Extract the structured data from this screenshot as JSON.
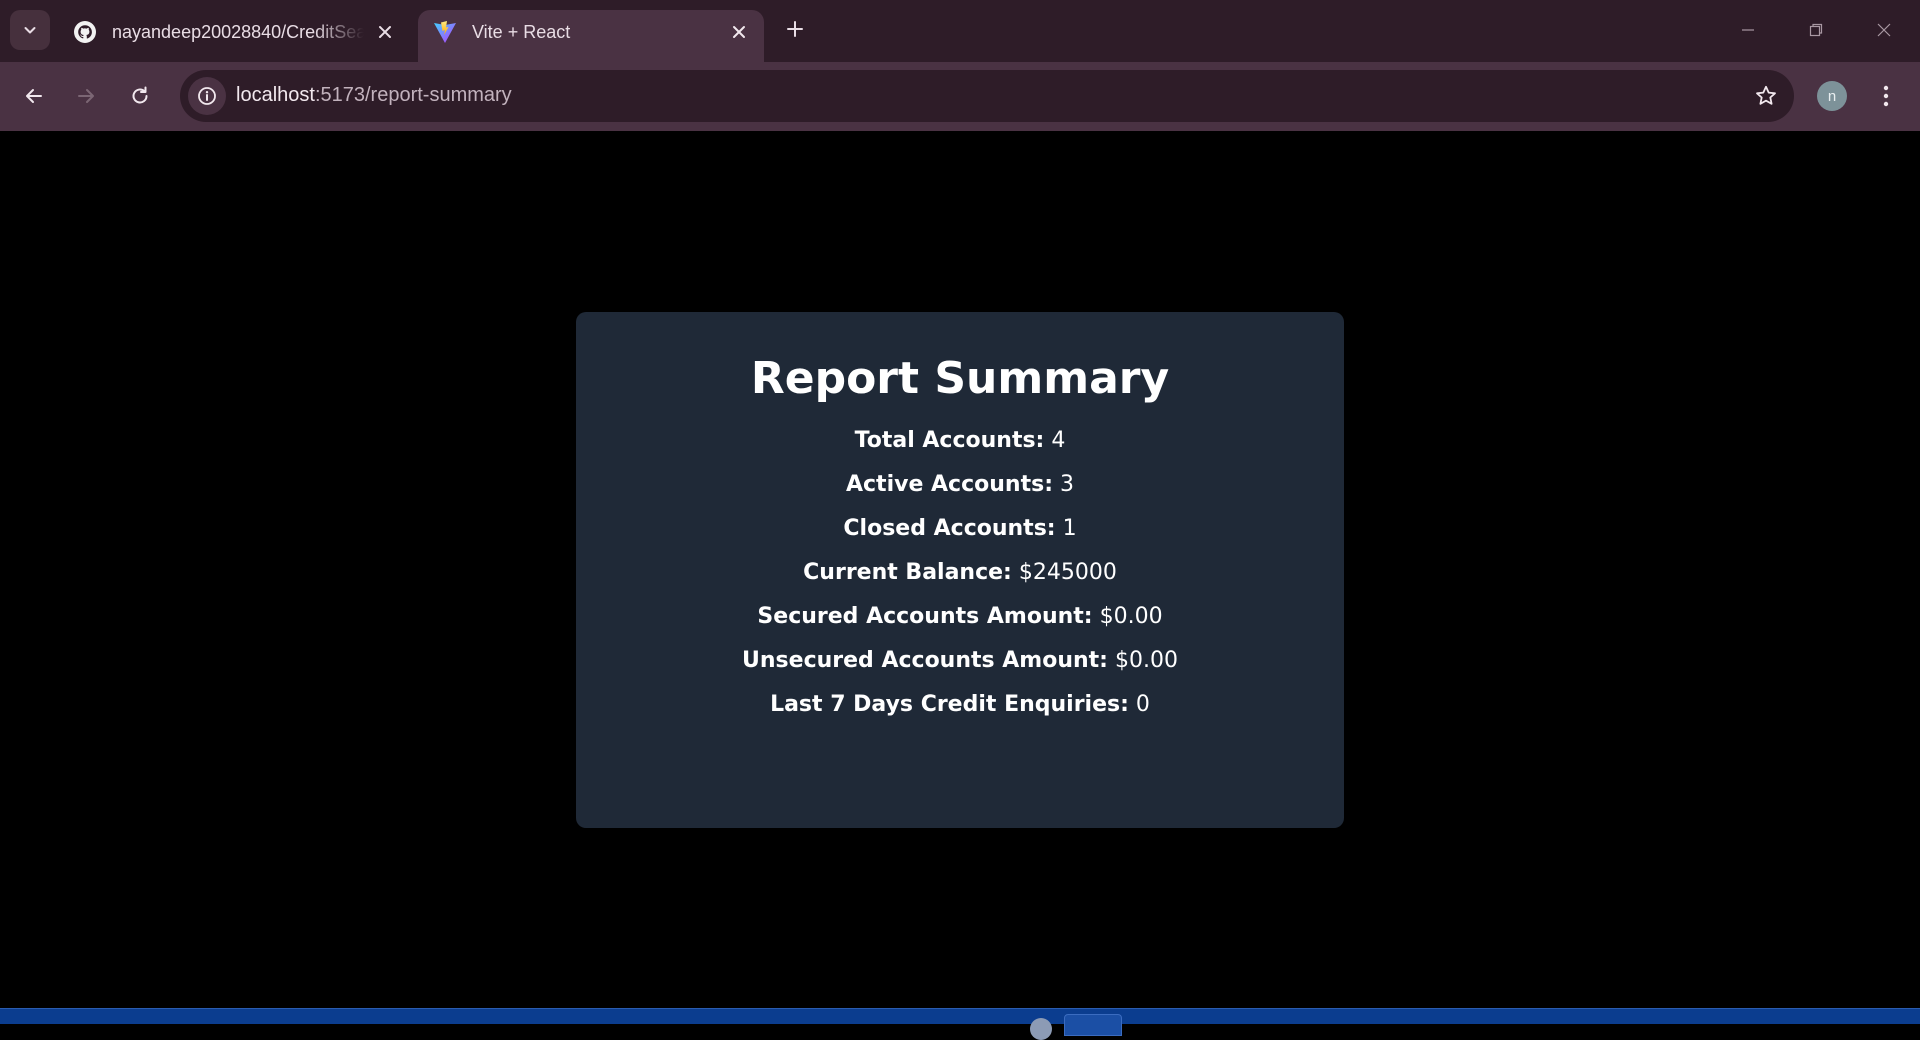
{
  "browser": {
    "tabs": [
      {
        "title": "nayandeep20028840/CreditSea",
        "favicon": "github-icon",
        "active": false
      },
      {
        "title": "Vite + React",
        "favicon": "vite-icon",
        "active": true
      }
    ],
    "address_bar": {
      "host": "localhost",
      "port_path": ":5173/report-summary"
    },
    "profile_initial": "n",
    "theme_colors": {
      "tabstrip": "#2e1c28",
      "toolbar": "#4a3243"
    }
  },
  "page": {
    "background": "#000000",
    "card_background": "#1f2937",
    "title": "Report Summary",
    "stats": [
      {
        "label": "Total Accounts:",
        "value": "4"
      },
      {
        "label": "Active Accounts:",
        "value": "3"
      },
      {
        "label": "Closed Accounts:",
        "value": "1"
      },
      {
        "label": "Current Balance:",
        "value": "$245000"
      },
      {
        "label": "Secured Accounts Amount:",
        "value": "$0.00"
      },
      {
        "label": "Unsecured Accounts Amount:",
        "value": "$0.00"
      },
      {
        "label": "Last 7 Days Credit Enquiries:",
        "value": "0"
      }
    ]
  },
  "taskbar": {
    "color": "#0b3d8f"
  }
}
